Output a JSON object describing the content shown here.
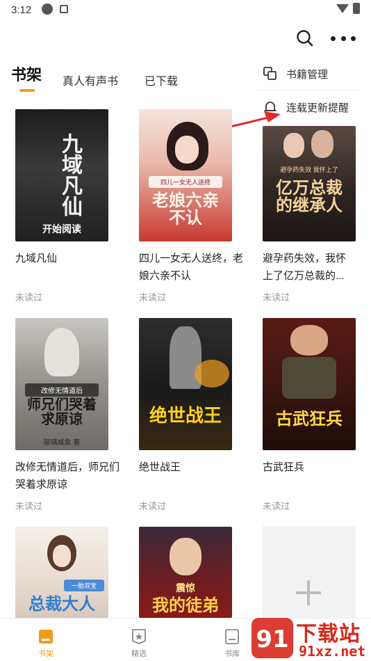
{
  "status_bar": {
    "time": "3:12"
  },
  "tabs": [
    {
      "label": "书架",
      "active": true
    },
    {
      "label": "真人有声书",
      "active": false
    },
    {
      "label": "已下载",
      "active": false
    }
  ],
  "popup_menu": {
    "items": [
      {
        "label": "书籍管理",
        "icon": "copy-icon"
      },
      {
        "label": "连载更新提醒",
        "icon": "bell-icon"
      }
    ]
  },
  "books": [
    {
      "title": "九域凡仙",
      "status": "未读过",
      "cover_title": "九域凡仙",
      "cover_tag": "",
      "cover_author": "",
      "cover_cta": "开始阅读"
    },
    {
      "title": "四儿一女无人送终，老娘六亲不认",
      "status": "未读过",
      "cover_title": "老娘六亲不认",
      "cover_tag": "四儿一女无人送终",
      "cover_author": "",
      "cover_cta": ""
    },
    {
      "title": "避孕药失效，我怀上了亿万总裁的...",
      "status": "未读过",
      "cover_title": "亿万总裁的继承人",
      "cover_tag": "避孕药失效 我怀上了",
      "cover_author": "",
      "cover_cta": ""
    },
    {
      "title": "改修无情道后，师兄们哭着求原谅",
      "status": "未读过",
      "cover_title": "师兄们哭着求原谅",
      "cover_tag": "改修无情道后",
      "cover_author": "玻璃咸鱼 著",
      "cover_cta": ""
    },
    {
      "title": "绝世战王",
      "status": "未读过",
      "cover_title": "绝世战王",
      "cover_tag": "",
      "cover_author": "",
      "cover_cta": ""
    },
    {
      "title": "古武狂兵",
      "status": "未读过",
      "cover_title": "古武狂兵",
      "cover_tag": "",
      "cover_author": "",
      "cover_cta": ""
    },
    {
      "title": "",
      "status": "",
      "cover_title": "总裁大人",
      "cover_tag": "一胎双宝",
      "cover_author": "",
      "cover_cta": ""
    },
    {
      "title": "",
      "status": "",
      "cover_title": "我的徒弟",
      "cover_tag": "震惊",
      "cover_author": "",
      "cover_cta": ""
    }
  ],
  "bottom_nav": [
    {
      "label": "书架",
      "active": true
    },
    {
      "label": "精选",
      "active": false
    },
    {
      "label": "书库",
      "active": false
    }
  ],
  "watermark": {
    "text": "下载站",
    "url": "91xz.net",
    "logo_text": "91"
  },
  "colors": {
    "accent": "#f29b19",
    "annotation_arrow": "#e02b2b",
    "watermark": "#d7281b"
  }
}
